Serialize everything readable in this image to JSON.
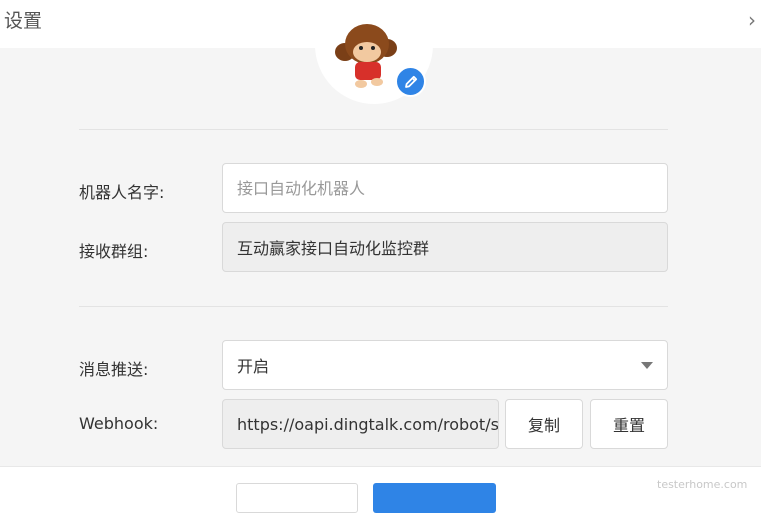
{
  "header": {
    "title": "设置"
  },
  "form": {
    "robot_name_label": "机器人名字:",
    "robot_name_placeholder": "接口自动化机器人",
    "group_label": "接收群组:",
    "group_value": "互动赢家接口自动化监控群",
    "push_label": "消息推送:",
    "push_value": "开启",
    "webhook_label": "Webhook:",
    "webhook_value": "https://oapi.dingtalk.com/robot/send?access_token=",
    "copy_label": "复制",
    "reset_label": "重置"
  },
  "watermark": "testerhome.com",
  "colors": {
    "primary": "#2f84e6",
    "panel": "#f5f5f5",
    "readonly": "#eeeeee"
  }
}
